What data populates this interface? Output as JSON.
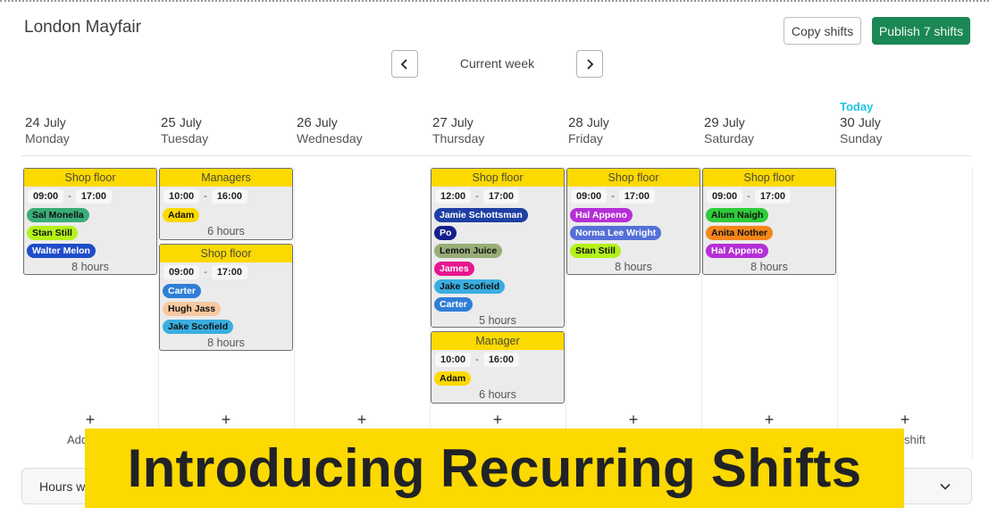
{
  "header": {
    "location": "London Mayfair",
    "copy_label": "Copy shifts",
    "publish_label": "Publish 7 shifts",
    "week_label": "Current week"
  },
  "colors": {
    "accent_green": "#1b8755",
    "shift_header": "#fcd900",
    "today": "#22c3e6"
  },
  "days": [
    {
      "day": "24",
      "month": "July",
      "weekday": "Monday",
      "today_label": ""
    },
    {
      "day": "25",
      "month": "July",
      "weekday": "Tuesday",
      "today_label": ""
    },
    {
      "day": "26",
      "month": "July",
      "weekday": "Wednesday",
      "today_label": ""
    },
    {
      "day": "27",
      "month": "July",
      "weekday": "Thursday",
      "today_label": ""
    },
    {
      "day": "28",
      "month": "July",
      "weekday": "Friday",
      "today_label": ""
    },
    {
      "day": "29",
      "month": "July",
      "weekday": "Saturday",
      "today_label": ""
    },
    {
      "day": "30",
      "month": "July",
      "weekday": "Sunday",
      "today_label": "Today"
    }
  ],
  "shifts": [
    {
      "day": 0,
      "role": "Shop floor",
      "start": "09:00",
      "end": "17:00",
      "hours": "8 hours",
      "staff": [
        {
          "name": "Sal Monella",
          "bg": "#3aad78",
          "fg": "#111"
        },
        {
          "name": "Stan Still",
          "bg": "#b3f21a",
          "fg": "#111"
        },
        {
          "name": "Walter Melon",
          "bg": "#1f4cc9",
          "fg": "#fff"
        }
      ]
    },
    {
      "day": 1,
      "role": "Managers",
      "start": "10:00",
      "end": "16:00",
      "hours": "6 hours",
      "staff": [
        {
          "name": "Adam",
          "bg": "#fcd900",
          "fg": "#111"
        }
      ]
    },
    {
      "day": 1,
      "role": "Shop floor",
      "start": "09:00",
      "end": "17:00",
      "hours": "8 hours",
      "staff": [
        {
          "name": "Carter",
          "bg": "#2f7fd6",
          "fg": "#fff"
        },
        {
          "name": "Hugh Jass",
          "bg": "#f6c9a0",
          "fg": "#111"
        },
        {
          "name": "Jake Scofield",
          "bg": "#3aaee0",
          "fg": "#111"
        }
      ]
    },
    {
      "day": 3,
      "role": "Shop floor",
      "start": "12:00",
      "end": "17:00",
      "hours": "5 hours",
      "staff": [
        {
          "name": "Jamie Schottsman",
          "bg": "#1f3fa3",
          "fg": "#fff"
        },
        {
          "name": "Po",
          "bg": "#14208a",
          "fg": "#fff"
        },
        {
          "name": "Lemon Juice",
          "bg": "#98ad78",
          "fg": "#111"
        },
        {
          "name": "James",
          "bg": "#e8178f",
          "fg": "#fff"
        },
        {
          "name": "Jake Scofield",
          "bg": "#3aaee0",
          "fg": "#111"
        },
        {
          "name": "Carter",
          "bg": "#2f7fd6",
          "fg": "#fff"
        }
      ]
    },
    {
      "day": 3,
      "role": "Manager",
      "start": "10:00",
      "end": "16:00",
      "hours": "6 hours",
      "staff": [
        {
          "name": "Adam",
          "bg": "#fcd900",
          "fg": "#111"
        }
      ]
    },
    {
      "day": 4,
      "role": "Shop floor",
      "start": "09:00",
      "end": "17:00",
      "hours": "8 hours",
      "staff": [
        {
          "name": "Hal Appeno",
          "bg": "#b52fd6",
          "fg": "#fff"
        },
        {
          "name": "Norma Lee Wright",
          "bg": "#5470d8",
          "fg": "#fff"
        },
        {
          "name": "Stan Still",
          "bg": "#b3f21a",
          "fg": "#111"
        }
      ]
    },
    {
      "day": 5,
      "role": "Shop floor",
      "start": "09:00",
      "end": "17:00",
      "hours": "8 hours",
      "staff": [
        {
          "name": "Alum Naigh",
          "bg": "#2fcb3a",
          "fg": "#111"
        },
        {
          "name": "Anita Nother",
          "bg": "#f5861a",
          "fg": "#111"
        },
        {
          "name": "Hal Appeno",
          "bg": "#b52fd6",
          "fg": "#fff"
        }
      ]
    }
  ],
  "add": {
    "plus": "+",
    "label_left": "Add",
    "label_right": "shift"
  },
  "hours_bar": {
    "label": "Hours wo"
  },
  "banner": {
    "text": "Introducing Recurring Shifts"
  }
}
